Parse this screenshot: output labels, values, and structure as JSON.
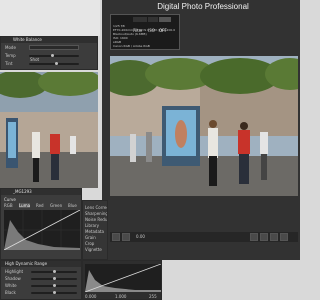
{
  "app": {
    "title": "Digital Photo Professional"
  },
  "white_balance": {
    "title": "White Balance",
    "mode_label": "Mode",
    "mode_value": "Shot",
    "rows": [
      {
        "label": "Temp",
        "value": ""
      },
      {
        "label": "Tint",
        "value": ""
      }
    ]
  },
  "info_overlay": {
    "tabs": [
      "Filter",
      "ISO",
      "OFF"
    ],
    "lines": [
      "1/25 f/8",
      "EF70-200mm f/2.8L IS II USM (70.0-200.0",
      "Blackout/Auto (6.6MB)",
      "ISO: 1600",
      "sRGB",
      "Canon RGB / Adobe RGB"
    ]
  },
  "file": {
    "name": "_MG1293"
  },
  "curve": {
    "title": "Curve",
    "tabs": [
      "RGB",
      "Luma",
      "Red",
      "Green",
      "Blue"
    ]
  },
  "side_list": {
    "items": [
      "Lens Correction",
      "Sharpening",
      "Noise Reduction",
      "Library",
      "Metadata",
      "Grain",
      "Crop",
      "Vignette"
    ]
  },
  "hdr": {
    "title": "High Dynamic Range",
    "rows": [
      "Highlight",
      "Shadow",
      "White",
      "Black"
    ]
  },
  "toolbar": {
    "zoom_value": "0.00"
  },
  "levels": {
    "readout": [
      "0.000",
      "1.000",
      "255"
    ]
  },
  "colors": {
    "panel": "#3c3c3c",
    "dark": "#2a2a2a",
    "accent": "#4aa3df"
  }
}
